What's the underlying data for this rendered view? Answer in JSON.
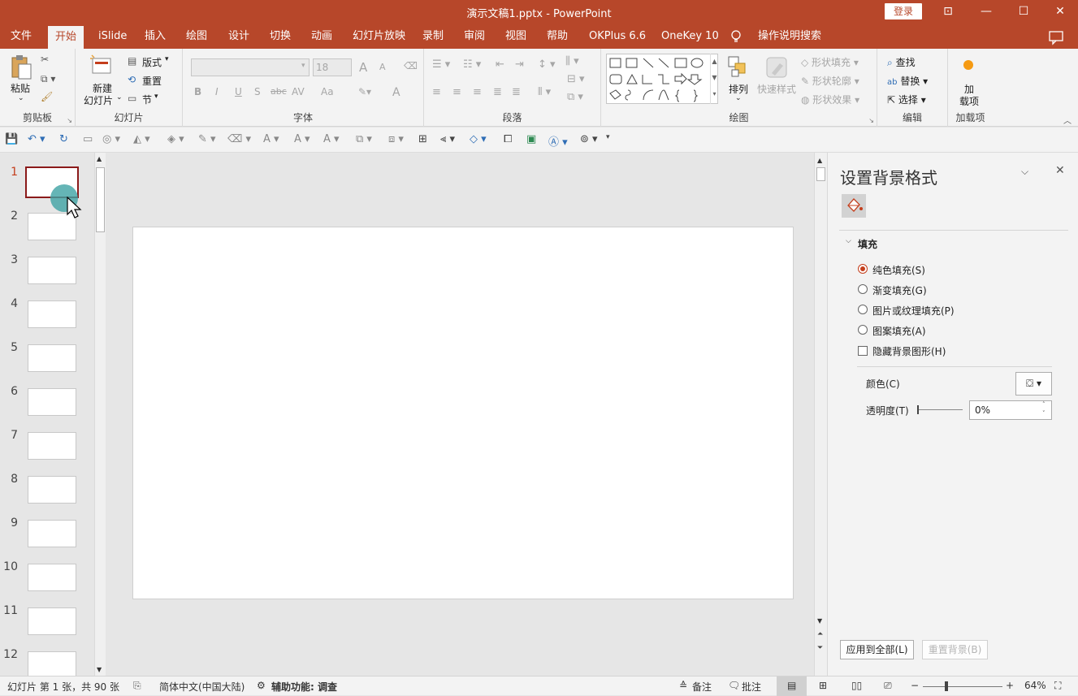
{
  "titlebar": {
    "title": "演示文稿1.pptx  -  PowerPoint",
    "login": "登录",
    "ribbon_display": "⊡",
    "minimize": "—",
    "maximize": "☐",
    "close": "✕"
  },
  "tabs": [
    {
      "label": "文件"
    },
    {
      "label": "开始"
    },
    {
      "label": "iSlide"
    },
    {
      "label": "插入"
    },
    {
      "label": "绘图"
    },
    {
      "label": "设计"
    },
    {
      "label": "切换"
    },
    {
      "label": "动画"
    },
    {
      "label": "幻灯片放映"
    },
    {
      "label": "录制"
    },
    {
      "label": "审阅"
    },
    {
      "label": "视图"
    },
    {
      "label": "帮助"
    },
    {
      "label": "OKPlus 6.6"
    },
    {
      "label": "OneKey 10"
    }
  ],
  "tell_me": "操作说明搜索",
  "ribbon": {
    "clipboard": {
      "paste": "粘贴",
      "label": "剪贴板"
    },
    "slides": {
      "new_slide_1": "新建",
      "new_slide_2": "幻灯片",
      "layout": "版式",
      "reset": "重置",
      "section": "节",
      "label": "幻灯片"
    },
    "font": {
      "size": "18",
      "label": "字体",
      "bold": "B",
      "italic": "I",
      "underline": "U",
      "shadow": "S",
      "strike": "abc",
      "spacing": "AV",
      "case": "Aa",
      "color": "A",
      "grow": "A",
      "shrink": "A"
    },
    "paragraph": {
      "label": "段落"
    },
    "drawing": {
      "arrange": "排列",
      "quick_styles": "快速样式",
      "shape_fill": "形状填充",
      "shape_outline": "形状轮廓",
      "shape_effects": "形状效果",
      "label": "绘图"
    },
    "editing": {
      "find": "查找",
      "replace": "替换",
      "select": "选择",
      "label": "编辑"
    },
    "addins": {
      "load_1": "加",
      "load_2": "载项",
      "label": "加载项"
    }
  },
  "slides": [
    "1",
    "2",
    "3",
    "4",
    "5",
    "6",
    "7",
    "8",
    "9",
    "10",
    "11",
    "12"
  ],
  "pane": {
    "title": "设置背景格式",
    "section": "填充",
    "options": [
      "纯色填充(S)",
      "渐变填充(G)",
      "图片或纹理填充(P)",
      "图案填充(A)"
    ],
    "hide_bg": "隐藏背景图形(H)",
    "color_label": "颜色(C)",
    "transparency_label": "透明度(T)",
    "transparency_value": "0%",
    "apply_all": "应用到全部(L)",
    "reset_bg": "重置背景(B)"
  },
  "status": {
    "slide_info": "幻灯片 第 1 张，共 90 张",
    "language": "简体中文(中国大陆)",
    "accessibility": "辅助功能: 调查",
    "notes": "备注",
    "comments": "批注",
    "zoom": "64%"
  },
  "colors": {
    "brand": "#b7472a",
    "accent": "#c43e1c",
    "selected_thumb": "#8b1a1a",
    "cursor_dot": "#3fa3a4"
  }
}
